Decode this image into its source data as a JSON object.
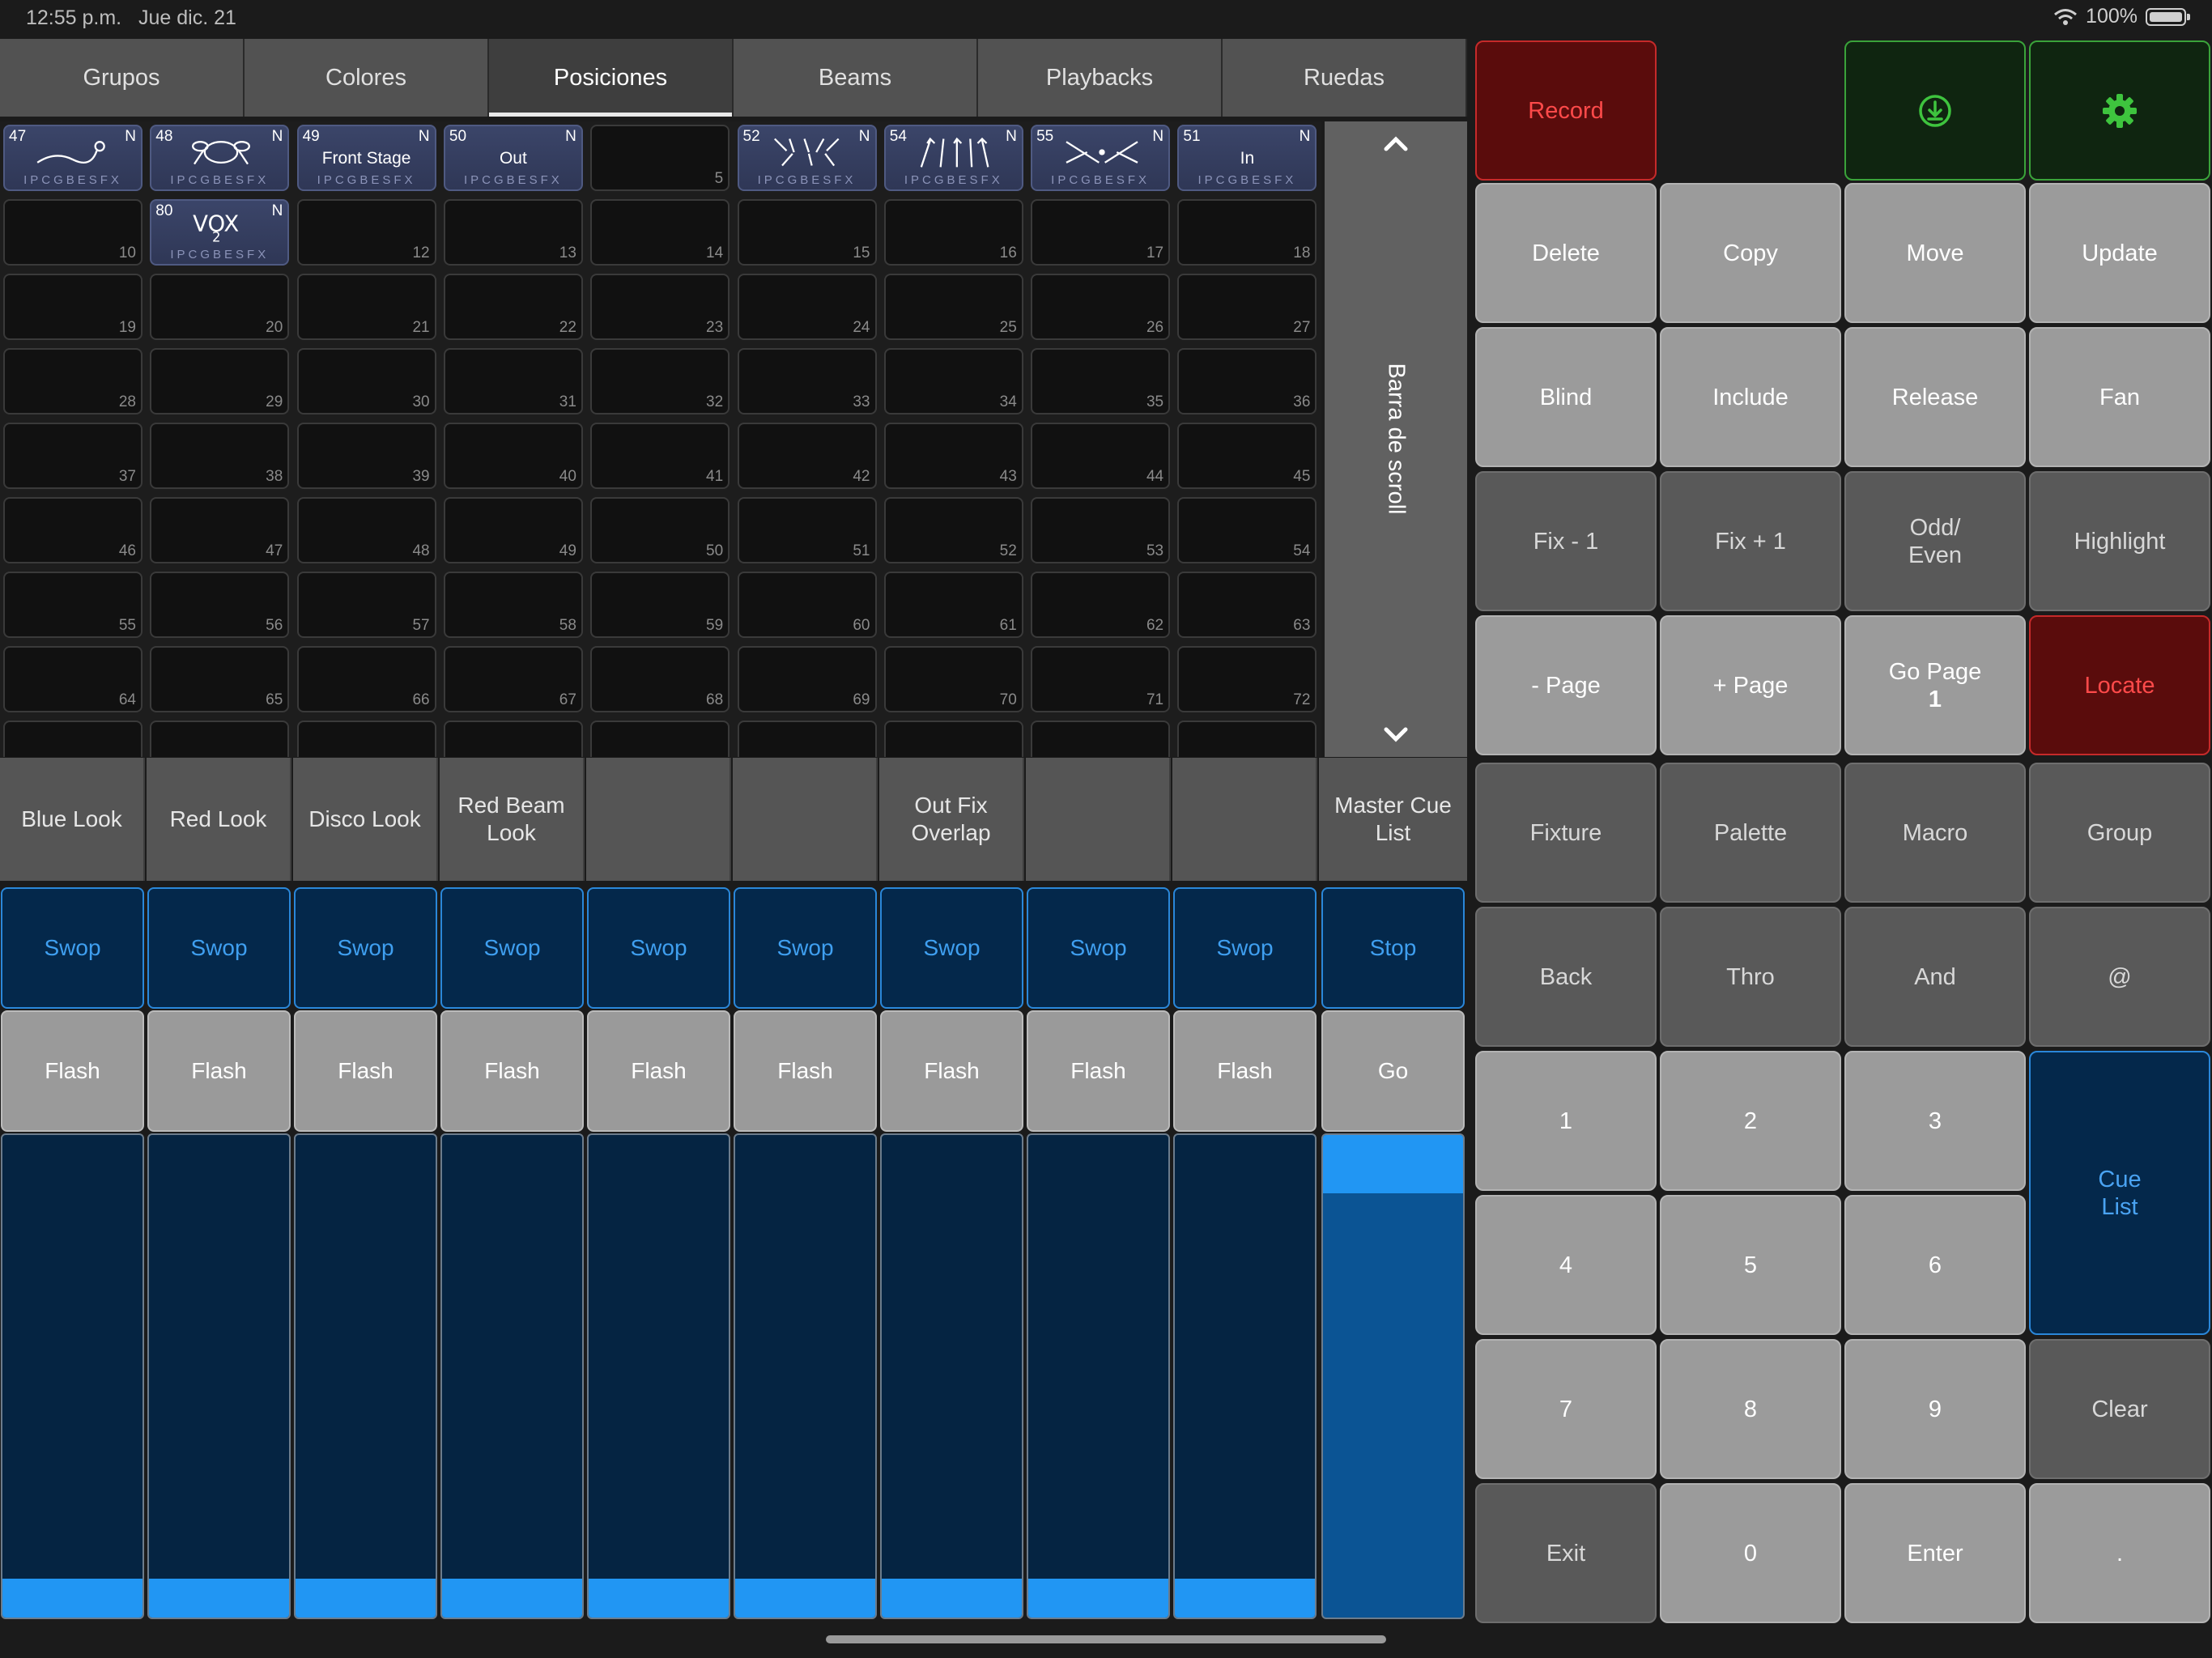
{
  "status": {
    "time": "12:55 p.m.",
    "date": "Jue dic. 21",
    "battery": "100%"
  },
  "tabs": [
    {
      "label": "Grupos"
    },
    {
      "label": "Colores"
    },
    {
      "label": "Posiciones"
    },
    {
      "label": "Beams"
    },
    {
      "label": "Playbacks"
    },
    {
      "label": "Ruedas"
    }
  ],
  "active_tab": "Posiciones",
  "palette_attrs": "IPCGBESFX",
  "palettes": [
    {
      "slot": 1,
      "id": "47",
      "name": "",
      "flag": "N",
      "icon": "spot-icon"
    },
    {
      "slot": 2,
      "id": "48",
      "name": "",
      "flag": "N",
      "icon": "drums-icon"
    },
    {
      "slot": 3,
      "id": "49",
      "name": "Front Stage",
      "flag": "N"
    },
    {
      "slot": 4,
      "id": "50",
      "name": "Out",
      "flag": "N"
    },
    {
      "slot": 6,
      "id": "52",
      "name": "",
      "flag": "N",
      "icon": "arrows-down-icon"
    },
    {
      "slot": 7,
      "id": "54",
      "name": "",
      "flag": "N",
      "icon": "arrows-up-icon"
    },
    {
      "slot": 8,
      "id": "55",
      "name": "",
      "flag": "N",
      "icon": "arrows-cross-icon"
    },
    {
      "slot": 9,
      "id": "51",
      "name": "In",
      "flag": "N"
    },
    {
      "slot": 11,
      "id": "80",
      "name": "",
      "flag": "N",
      "icon": "vox-icon"
    }
  ],
  "scroll": {
    "label": "Barra de scroll",
    "up_icon": "chevron-up-icon",
    "down_icon": "chevron-down-icon"
  },
  "playbacks": [
    {
      "name": "Blue Look",
      "top": "Swop",
      "bottom": "Flash",
      "level": 0.08
    },
    {
      "name": "Red Look",
      "top": "Swop",
      "bottom": "Flash",
      "level": 0.08
    },
    {
      "name": "Disco Look",
      "top": "Swop",
      "bottom": "Flash",
      "level": 0.08
    },
    {
      "name": "Red Beam Look",
      "top": "Swop",
      "bottom": "Flash",
      "level": 0.08
    },
    {
      "name": "",
      "top": "Swop",
      "bottom": "Flash",
      "level": 0.08
    },
    {
      "name": "",
      "top": "Swop",
      "bottom": "Flash",
      "level": 0.08
    },
    {
      "name": "Out Fix Overlap",
      "top": "Swop",
      "bottom": "Flash",
      "level": 0.08
    },
    {
      "name": "",
      "top": "Swop",
      "bottom": "Flash",
      "level": 0.08
    },
    {
      "name": "",
      "top": "Swop",
      "bottom": "Flash",
      "level": 0.08
    }
  ],
  "master": {
    "name": "Master Cue List",
    "top": "Stop",
    "bottom": "Go",
    "level": 1.0
  },
  "keys": {
    "record": "Record",
    "download_icon": "download-icon",
    "settings_icon": "gear-icon",
    "delete": "Delete",
    "copy": "Copy",
    "move": "Move",
    "update": "Update",
    "blind": "Blind",
    "include": "Include",
    "release": "Release",
    "fan": "Fan",
    "fix_minus": "Fix - 1",
    "fix_plus": "Fix + 1",
    "odd_even": "Odd/ Even",
    "highlight": "Highlight",
    "page_minus": "- Page",
    "page_plus": "+ Page",
    "go_page": "Go Page",
    "go_page_num": "1",
    "locate": "Locate",
    "fixture": "Fixture",
    "palette": "Palette",
    "macro": "Macro",
    "group": "Group",
    "back": "Back",
    "thro": "Thro",
    "and": "And",
    "at": "@",
    "n1": "1",
    "n2": "2",
    "n3": "3",
    "cue_list": "Cue List",
    "n4": "4",
    "n5": "5",
    "n6": "6",
    "n7": "7",
    "n8": "8",
    "n9": "9",
    "clear": "Clear",
    "exit": "Exit",
    "n0": "0",
    "enter": "Enter",
    "dot": "."
  },
  "colors": {
    "accent_blue": "#2196f3",
    "record_red": "#ff4a4a",
    "settings_green": "#3ec43e"
  }
}
